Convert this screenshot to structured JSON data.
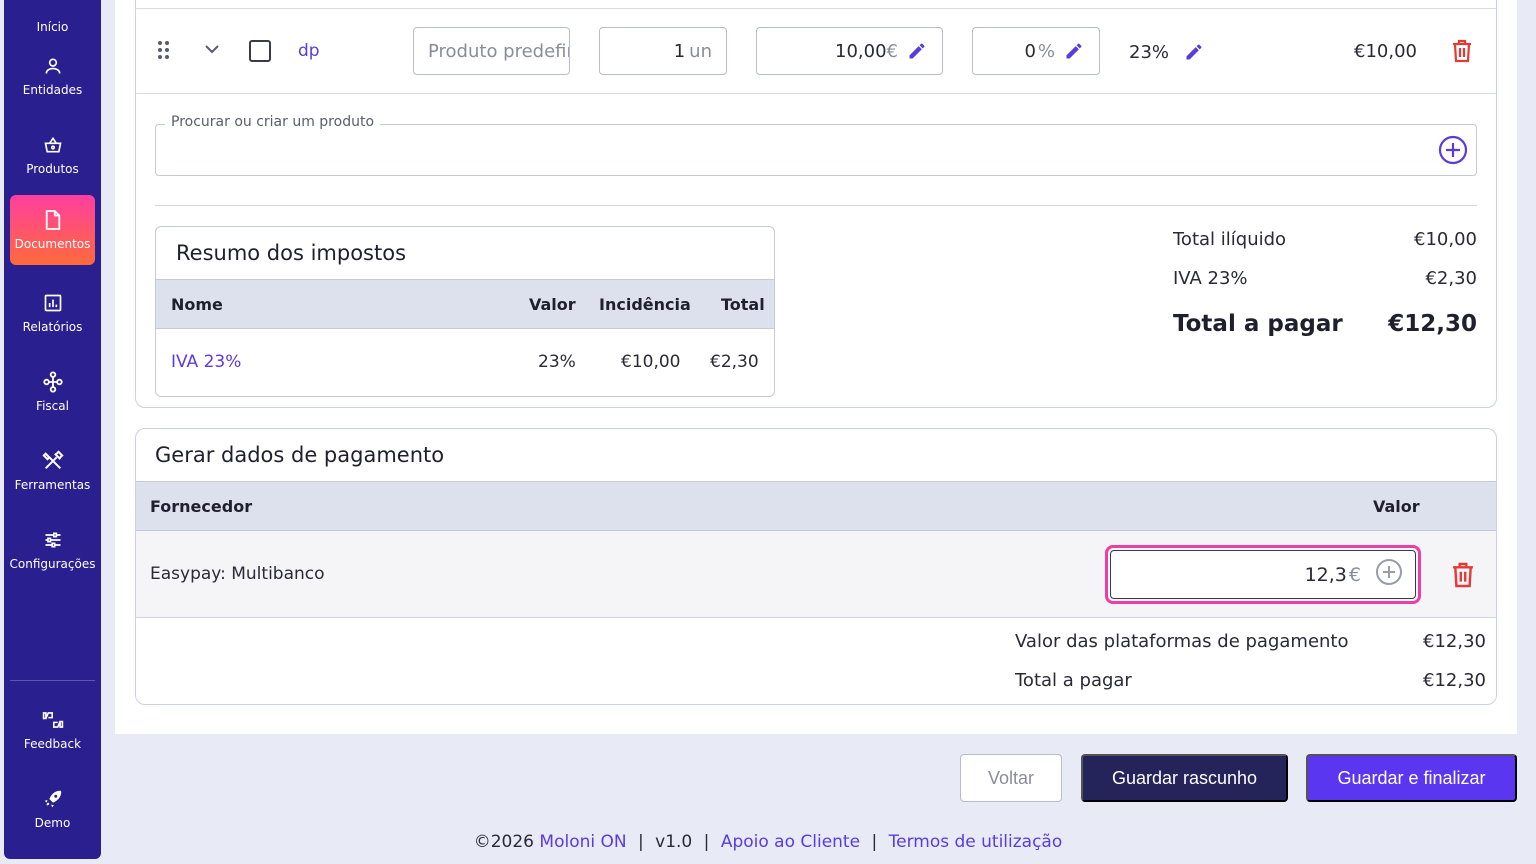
{
  "sidebar": {
    "items": [
      {
        "label": "Início",
        "icon": "home-icon"
      },
      {
        "label": "Entidades",
        "icon": "person-icon"
      },
      {
        "label": "Produtos",
        "icon": "basket-icon"
      },
      {
        "label": "Documentos",
        "icon": "document-icon"
      },
      {
        "label": "Relatórios",
        "icon": "chart-icon"
      },
      {
        "label": "Fiscal",
        "icon": "network-icon"
      },
      {
        "label": "Ferramentas",
        "icon": "tools-icon"
      },
      {
        "label": "Configurações",
        "icon": "sliders-icon"
      },
      {
        "label": "Feedback",
        "icon": "thumbs-icon"
      },
      {
        "label": "Demo",
        "icon": "rocket-icon"
      }
    ]
  },
  "product_row": {
    "code": "dp",
    "name_placeholder": "Produto predefinido",
    "quantity": "1",
    "quantity_unit": "un",
    "price": "10,00",
    "price_unit": "€",
    "discount": "0",
    "discount_unit": "%",
    "tax": "23%",
    "total": "€10,00"
  },
  "search": {
    "legend": "Procurar ou criar um produto"
  },
  "tax_summary": {
    "title": "Resumo dos impostos",
    "headers": {
      "name": "Nome",
      "value": "Valor",
      "incidence": "Incidência",
      "total": "Total"
    },
    "rows": [
      {
        "name": "IVA 23%",
        "value": "23%",
        "incidence": "€10,00",
        "total": "€2,30"
      }
    ]
  },
  "totals": {
    "net_label": "Total ilíquido",
    "net_value": "€10,00",
    "vat_label": "IVA 23%",
    "vat_value": "€2,30",
    "due_label": "Total a pagar",
    "due_value": "€12,30"
  },
  "payment": {
    "title": "Gerar dados de pagamento",
    "headers": {
      "provider": "Fornecedor",
      "value": "Valor"
    },
    "row": {
      "provider": "Easypay: Multibanco",
      "amount": "12,3",
      "unit": "€"
    },
    "platforms_label": "Valor das plataformas de pagamento",
    "platforms_value": "€12,30",
    "due_label": "Total a pagar",
    "due_value": "€12,30"
  },
  "buttons": {
    "back": "Voltar",
    "draft": "Guardar rascunho",
    "finalize": "Guardar e finalizar"
  },
  "footer": {
    "copyright": "©2026",
    "brand": "Moloni ON",
    "version": "v1.0",
    "support": "Apoio ao Cliente",
    "terms": "Termos de utilização"
  },
  "colors": {
    "sidebar": "#2a1f8f",
    "accent": "#5b36f0",
    "link": "#5a3be0",
    "danger": "#e53935",
    "highlight": "#ea3fa8"
  }
}
